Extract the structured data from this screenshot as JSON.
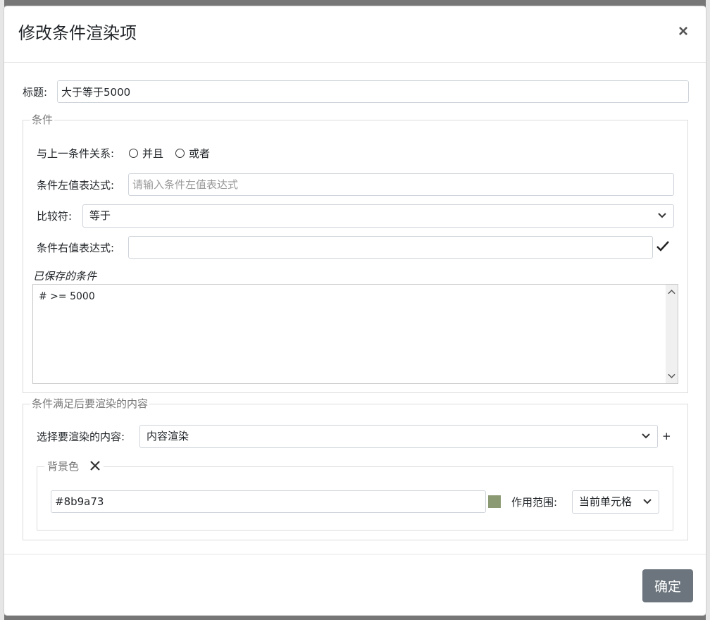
{
  "dialog": {
    "title": "修改条件渲染项",
    "close_label": "×"
  },
  "title_field": {
    "label": "标题:",
    "value": "大于等于5000"
  },
  "condition_section": {
    "legend": "条件",
    "relation_label": "与上一条件关系:",
    "relation_options": [
      "并且",
      "或者"
    ],
    "left_expr_label": "条件左值表达式:",
    "left_expr_placeholder": "请输入条件左值表达式",
    "left_expr_value": "",
    "comparator_label": "比较符:",
    "comparator_value": "等于",
    "right_expr_label": "条件右值表达式:",
    "right_expr_value": "",
    "confirm_icon": "check-icon",
    "saved_label": "已保存的条件",
    "saved_conditions": "# >= 5000"
  },
  "render_section": {
    "legend": "条件满足后要渲染的内容",
    "select_label": "选择要渲染的内容:",
    "select_value": "内容渲染",
    "add_label": "+",
    "background": {
      "legend": "背景色",
      "remove_icon": "close-x-icon",
      "color_value": "#8b9a73",
      "swatch_color": "#8b9a73",
      "scope_label": "作用范围:",
      "scope_value": "当前单元格"
    }
  },
  "footer": {
    "confirm_label": "确定"
  }
}
